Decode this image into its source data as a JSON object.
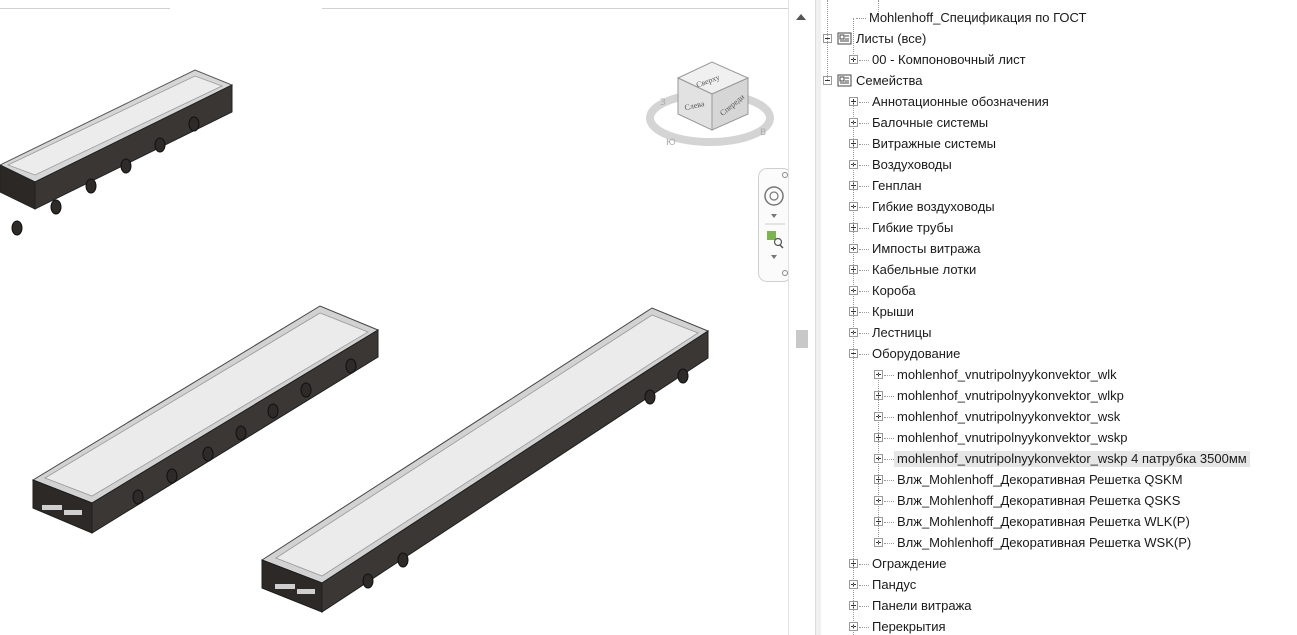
{
  "viewport": {
    "viewcube": {
      "top_label": "Сверху",
      "left_label": "Слева",
      "front_label": "Спереди"
    },
    "navbar": {
      "wheel_icon": "steering-wheel-icon",
      "zoom_icon": "zoom-region-icon"
    }
  },
  "browser": {
    "items": [
      {
        "label": "Mohlenhoff_Спецификация по ГОСТ",
        "level": 2,
        "toggle": "none"
      },
      {
        "label": "Листы (все)",
        "level": 0,
        "toggle": "minus",
        "icon": "sheets-icon"
      },
      {
        "label": "00 - Компоновочный лист",
        "level": 1,
        "toggle": "plus"
      },
      {
        "label": "Семейства",
        "level": 0,
        "toggle": "minus",
        "icon": "families-icon"
      },
      {
        "label": "Аннотационные обозначения",
        "level": 1,
        "toggle": "plus"
      },
      {
        "label": "Балочные системы",
        "level": 1,
        "toggle": "plus"
      },
      {
        "label": "Витражные системы",
        "level": 1,
        "toggle": "plus"
      },
      {
        "label": "Воздуховоды",
        "level": 1,
        "toggle": "plus"
      },
      {
        "label": "Генплан",
        "level": 1,
        "toggle": "plus"
      },
      {
        "label": "Гибкие воздуховоды",
        "level": 1,
        "toggle": "plus"
      },
      {
        "label": "Гибкие трубы",
        "level": 1,
        "toggle": "plus"
      },
      {
        "label": "Импосты витража",
        "level": 1,
        "toggle": "plus"
      },
      {
        "label": "Кабельные лотки",
        "level": 1,
        "toggle": "plus"
      },
      {
        "label": "Короба",
        "level": 1,
        "toggle": "plus"
      },
      {
        "label": "Крыши",
        "level": 1,
        "toggle": "plus"
      },
      {
        "label": "Лестницы",
        "level": 1,
        "toggle": "plus"
      },
      {
        "label": "Оборудование",
        "level": 1,
        "toggle": "minus"
      },
      {
        "label": "mohlenhof_vnutripolnyykonvektor_wlk",
        "level": 2,
        "toggle": "plus"
      },
      {
        "label": "mohlenhof_vnutripolnyykonvektor_wlkp",
        "level": 2,
        "toggle": "plus"
      },
      {
        "label": "mohlenhof_vnutripolnyykonvektor_wsk",
        "level": 2,
        "toggle": "plus"
      },
      {
        "label": "mohlenhof_vnutripolnyykonvektor_wskp",
        "level": 2,
        "toggle": "plus"
      },
      {
        "label": "mohlenhof_vnutripolnyykonvektor_wskp 4 патрубка 3500мм",
        "level": 2,
        "toggle": "plus",
        "selected": true
      },
      {
        "label": "Влж_Mohlenhoff_Декоративная Решетка QSKM",
        "level": 2,
        "toggle": "plus"
      },
      {
        "label": "Влж_Mohlenhoff_Декоративная Решетка QSKS",
        "level": 2,
        "toggle": "plus"
      },
      {
        "label": "Влж_Mohlenhoff_Декоративная Решетка WLK(P)",
        "level": 2,
        "toggle": "plus"
      },
      {
        "label": "Влж_Mohlenhoff_Декоративная Решетка WSK(P)",
        "level": 2,
        "toggle": "plus"
      },
      {
        "label": "Ограждение",
        "level": 1,
        "toggle": "plus"
      },
      {
        "label": "Пандус",
        "level": 1,
        "toggle": "plus"
      },
      {
        "label": "Панели витража",
        "level": 1,
        "toggle": "plus"
      },
      {
        "label": "Перекрытия",
        "level": 1,
        "toggle": "plus"
      }
    ]
  }
}
